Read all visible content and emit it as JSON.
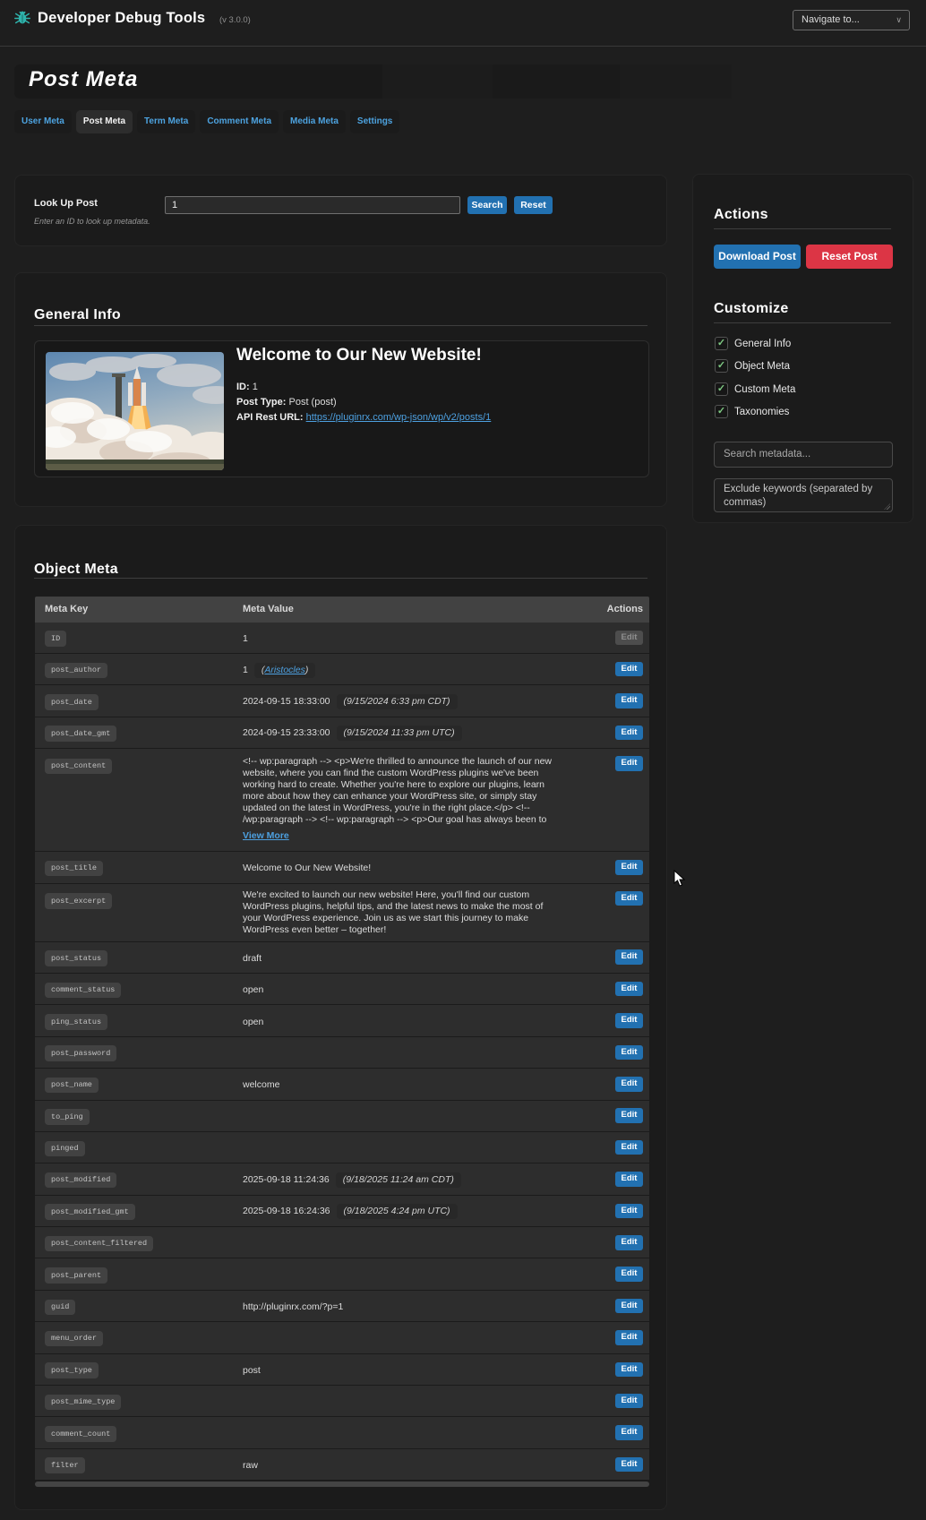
{
  "header": {
    "app_title": "Developer Debug Tools",
    "version": "(v 3.0.0)",
    "navigate_placeholder": "Navigate to..."
  },
  "page_title": "Post Meta",
  "tabs": [
    {
      "label": "User Meta",
      "active": false
    },
    {
      "label": "Post Meta",
      "active": true
    },
    {
      "label": "Term Meta",
      "active": false
    },
    {
      "label": "Comment Meta",
      "active": false
    },
    {
      "label": "Media Meta",
      "active": false
    },
    {
      "label": "Settings",
      "active": false
    }
  ],
  "lookup": {
    "label": "Look Up Post",
    "hint": "Enter an ID to look up metadata.",
    "value": "1",
    "search_label": "Search",
    "reset_label": "Reset"
  },
  "general_info": {
    "heading": "General Info",
    "post_title": "Welcome to Our New Website!",
    "id_label": "ID:",
    "id_value": "1",
    "type_label": "Post Type:",
    "type_value": "Post (post)",
    "api_label": "API Rest URL:",
    "api_url": "https://pluginrx.com/wp-json/wp/v2/posts/1",
    "image_name": "rocket-launch-featured-image"
  },
  "actions": {
    "heading": "Actions",
    "download_label": "Download Post",
    "reset_label": "Reset Post"
  },
  "customize": {
    "heading": "Customize",
    "options": [
      "General Info",
      "Object Meta",
      "Custom Meta",
      "Taxonomies"
    ],
    "search_placeholder": "Search metadata...",
    "exclude_placeholder": "Exclude keywords (separated by commas)"
  },
  "object_meta": {
    "heading": "Object Meta",
    "columns": [
      "Meta Key",
      "Meta Value",
      "Actions"
    ],
    "edit_label": "Edit",
    "view_more_label": "View More",
    "rows": [
      {
        "key": "ID",
        "value": "1",
        "disabled": true
      },
      {
        "key": "post_author",
        "value": "1",
        "author_link": "Aristocles"
      },
      {
        "key": "post_date",
        "value": "2024-09-15 18:33:00",
        "note": "(9/15/2024 6:33 pm CDT)"
      },
      {
        "key": "post_date_gmt",
        "value": "2024-09-15 23:33:00",
        "note": "(9/15/2024 11:33 pm UTC)"
      },
      {
        "key": "post_content",
        "value": "<!-- wp:paragraph -->  <p>We're thrilled to announce the launch of our new website, where you can find the custom WordPress plugins we've been working hard to create. Whether you're here to explore our plugins, learn more about how they can enhance your WordPress site, or simply stay updated on the latest in WordPress, you're in the right place.</p>  <!-- /wp:paragraph -->  <!-- wp:paragraph -->  <p>Our goal has always been to make WordPress m...",
        "tall": "content",
        "view_more": true
      },
      {
        "key": "post_title",
        "value": "Welcome to Our New Website!"
      },
      {
        "key": "post_excerpt",
        "value": "We're excited to launch our new website! Here, you'll find our custom WordPress plugins, helpful tips, and the latest news to make the most of your WordPress experience. Join us as we start this journey to make WordPress even better – together!",
        "tall": "excerpt"
      },
      {
        "key": "post_status",
        "value": "draft"
      },
      {
        "key": "comment_status",
        "value": "open"
      },
      {
        "key": "ping_status",
        "value": "open"
      },
      {
        "key": "post_password",
        "value": ""
      },
      {
        "key": "post_name",
        "value": "welcome"
      },
      {
        "key": "to_ping",
        "value": ""
      },
      {
        "key": "pinged",
        "value": ""
      },
      {
        "key": "post_modified",
        "value": "2025-09-18 11:24:36",
        "note": "(9/18/2025 11:24 am CDT)"
      },
      {
        "key": "post_modified_gmt",
        "value": "2025-09-18 16:24:36",
        "note": "(9/18/2025 4:24 pm UTC)"
      },
      {
        "key": "post_content_filtered",
        "value": ""
      },
      {
        "key": "post_parent",
        "value": ""
      },
      {
        "key": "guid",
        "value": "http://pluginrx.com/?p=1"
      },
      {
        "key": "menu_order",
        "value": ""
      },
      {
        "key": "post_type",
        "value": "post"
      },
      {
        "key": "post_mime_type",
        "value": ""
      },
      {
        "key": "comment_count",
        "value": ""
      },
      {
        "key": "filter",
        "value": "raw"
      }
    ]
  }
}
